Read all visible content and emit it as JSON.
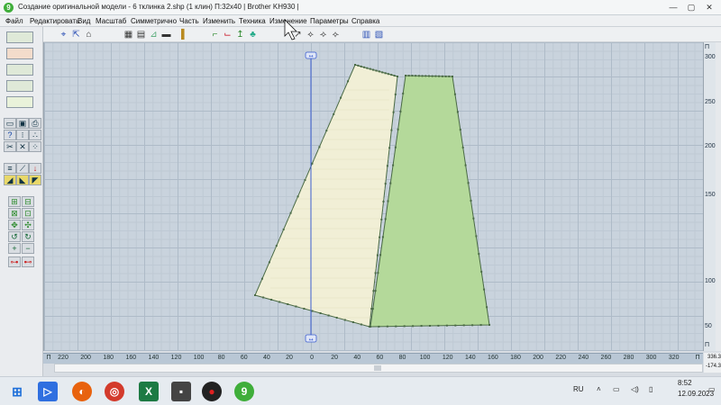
{
  "window": {
    "title": "Создание оригинальной модели - 6 тклинка 2.shp (1 клин)    П:32х40    | Brother KH930 |",
    "minimize": "—",
    "maximize": "▢",
    "close": "✕"
  },
  "menu": [
    "Файл",
    "Редактировать",
    "Вид",
    "Масштаб",
    "Симметрично",
    "Часть",
    "Изменить",
    "Техника",
    "Изменение",
    "Параметры",
    "Справка"
  ],
  "hruler": {
    "prefix": "П",
    "ticks": [
      "220",
      "200",
      "180",
      "160",
      "140",
      "120",
      "100",
      "80",
      "60",
      "40",
      "20",
      "0",
      "20",
      "40",
      "60",
      "80",
      "100",
      "120",
      "140",
      "160",
      "180",
      "200",
      "220",
      "240",
      "260",
      "280",
      "300",
      "320"
    ],
    "suffix": "П"
  },
  "vruler": {
    "prefix": "П",
    "ticks": [
      "300",
      "250",
      "200",
      "150",
      "100",
      "50",
      "0"
    ],
    "suffix": "П"
  },
  "coords": {
    "x": "336.3",
    "y": "-174.3"
  },
  "tray": {
    "lang": "RU",
    "time": "8:52",
    "date": "12.09.2023"
  },
  "colors": {
    "panel_left": "#f1efd6",
    "panel_right": "#b4d99a",
    "line": "#4a6a45",
    "axis": "#3a5cd0",
    "grid": "#aebbc8"
  },
  "taskbar_icons": [
    "windows-start-icon",
    "app-media-icon",
    "firefox-icon",
    "chrome-icon",
    "excel-icon",
    "camera-icon",
    "record-icon",
    "knitting-app-icon"
  ]
}
